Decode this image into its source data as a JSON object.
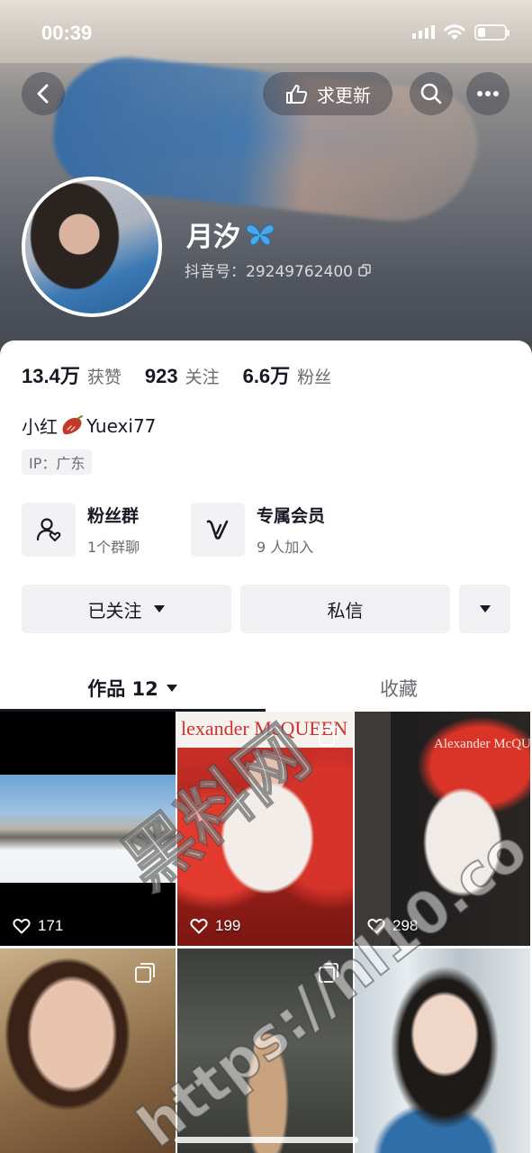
{
  "status_bar": {
    "time": "00:39"
  },
  "nav": {
    "request_update_label": "求更新"
  },
  "profile": {
    "name": "月汐",
    "douyin_id": "抖音号：29249762400"
  },
  "stats": [
    {
      "value": "13.4万",
      "label": "获赞"
    },
    {
      "value": "923",
      "label": "关注"
    },
    {
      "value": "6.6万",
      "label": "粉丝"
    }
  ],
  "bio": {
    "prefix": "小红",
    "handle": "Yuexi77"
  },
  "ip_location": "IP：广东",
  "features": [
    {
      "title": "粉丝群",
      "subtitle": "1个群聊",
      "icon": "fan-group-icon"
    },
    {
      "title": "专属会员",
      "subtitle": "9 人加入",
      "icon": "membership-icon"
    }
  ],
  "actions": {
    "follow_label": "已关注",
    "message_label": "私信"
  },
  "tabs": {
    "works_label": "作品 12",
    "favorites_label": "收藏"
  },
  "grid": [
    {
      "likes": "171"
    },
    {
      "likes": "199",
      "brand_text": "lexander McQUEEN"
    },
    {
      "likes": "298",
      "brand_text": "Alexander McQUEEN"
    },
    {
      "likes": ""
    },
    {
      "likes": ""
    },
    {
      "likes": ""
    }
  ],
  "watermark": {
    "line1": "黑料网",
    "line2": "https://hl10.co"
  },
  "colors": {
    "text_primary": "#161823",
    "text_secondary": "#6b6b73",
    "button_bg": "#f1f1f3"
  }
}
